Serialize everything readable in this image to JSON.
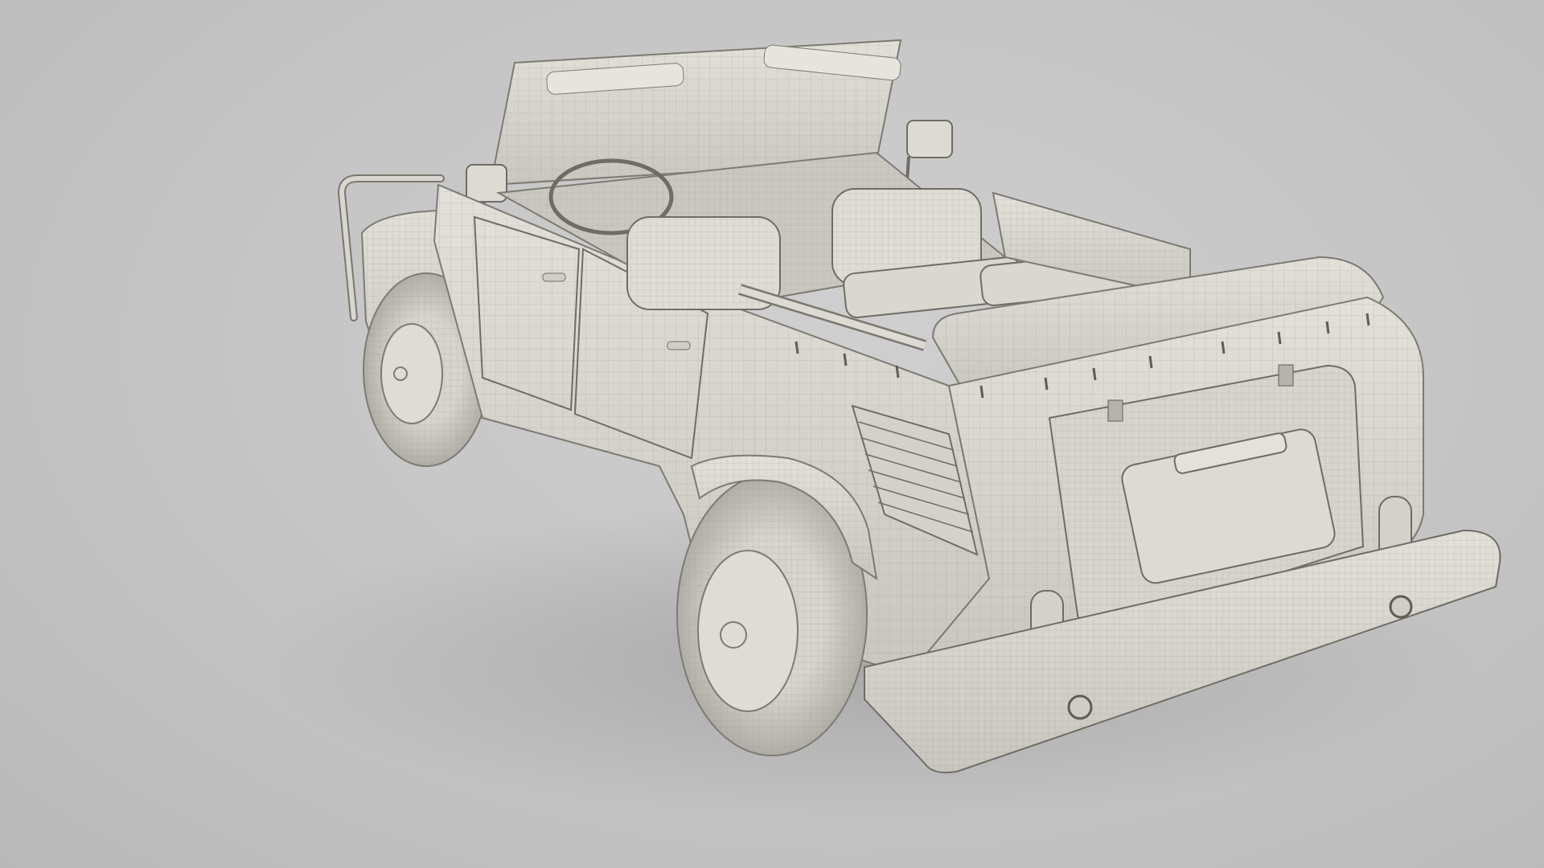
{
  "scene": {
    "background_color": "#c6c6c6",
    "model_color": "#d9d7d0",
    "wire_color": "#8f8c84",
    "shadow_color": "#9a9a9a"
  }
}
